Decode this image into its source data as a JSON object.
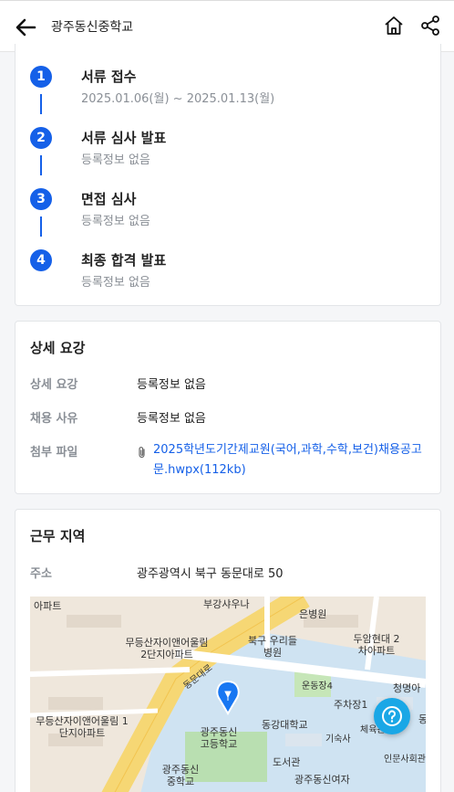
{
  "header": {
    "title": "광주동신중학교"
  },
  "steps": [
    {
      "number": "1",
      "title": "서류 접수",
      "sub": "2025.01.06(월) ~ 2025.01.13(월)"
    },
    {
      "number": "2",
      "title": "서류 심사 발표",
      "sub": "등록정보 없음"
    },
    {
      "number": "3",
      "title": "면접 심사",
      "sub": "등록정보 없음"
    },
    {
      "number": "4",
      "title": "최종 합격 발표",
      "sub": "등록정보 없음"
    }
  ],
  "details": {
    "title": "상세 요강",
    "rows": [
      {
        "label": "상세 요강",
        "value": "등록정보 없음"
      },
      {
        "label": "채용 사유",
        "value": "등록정보 없음"
      }
    ],
    "attach_label": "첨부 파일",
    "attach_file": "2025학년도기간제교원(국어,과학,수학,보건)채용공고문.hwpx(112kb)"
  },
  "location": {
    "title": "근무 지역",
    "address_label": "주소",
    "address": "광주광역시 북구 동문대로 50",
    "map_labels": [
      "부강샤우나",
      "은병원",
      "무등산자이앤어울림 2단지아파트",
      "북구 우리들병원",
      "두암현대 2차아파트",
      "동문대로",
      "운동장4",
      "청명아",
      "주차장1",
      "무등산자이앤어울림 1단지아파트",
      "광주동신 고등학교",
      "동강대학교",
      "체육관",
      "기숙사",
      "인문사회관",
      "도서관",
      "광주동신 중학교",
      "광주동신여자",
      "아파트",
      "동"
    ]
  },
  "colors": {
    "accent": "#1560e8",
    "help_button": "#1aa7e6",
    "muted_text": "#8a8f96"
  },
  "icons": {
    "back": "arrow-left-icon",
    "home": "home-icon",
    "share": "share-icon",
    "attachment": "paperclip-icon",
    "help": "question-icon",
    "map_pin": "map-pin-icon"
  }
}
